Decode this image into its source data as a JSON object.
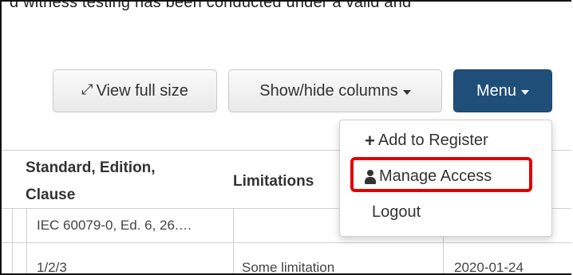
{
  "background_text": "d witness testing has been conducted under a valid and",
  "toolbar": {
    "view_full_size": "View full size",
    "show_hide_columns": "Show/hide columns",
    "menu": "Menu"
  },
  "menu_dropdown": {
    "items": [
      {
        "label": "Add to Register",
        "icon": "plus-icon"
      },
      {
        "label": "Manage Access",
        "icon": "user-icon",
        "highlighted": true
      },
      {
        "label": "Logout",
        "icon": ""
      }
    ]
  },
  "table": {
    "headers": {
      "standard_line1": "Standard, Edition,",
      "standard_line2": "Clause",
      "limitations": "Limitations"
    },
    "rows": [
      {
        "standard": "IEC 60079-0, Ed. 6, 26.…",
        "limitations": "",
        "date": ""
      },
      {
        "standard": "1/2/3",
        "limitations": "Some limitation",
        "date": "2020-01-24"
      }
    ]
  },
  "colors": {
    "menu_button": "#1f4e79",
    "highlight": "#e00000"
  }
}
